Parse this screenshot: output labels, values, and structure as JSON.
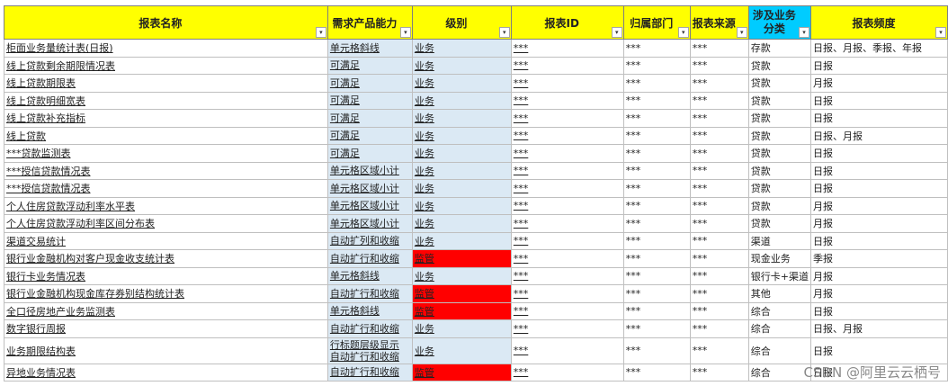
{
  "headers": [
    "报表名称",
    "需求产品能力",
    "级别",
    "报表ID",
    "归属部门",
    "报表来源",
    "涉及业务分类",
    "报表频度"
  ],
  "colors": {
    "header_yellow": "#ffff00",
    "header_cyan": "#00ccff",
    "level_red": "#ff0000",
    "link_purple": "#800080"
  },
  "rows": [
    {
      "name": "柜面业务量统计表(日报)",
      "cap": "单元格斜线",
      "level": "业务",
      "level_red": false,
      "id": "***",
      "dept": "***",
      "src": "***",
      "cat": "存款",
      "freq": "日报、月报、季报、年报"
    },
    {
      "name": "线上贷款剩余期限情况表",
      "cap": "可满足",
      "level": "业务",
      "level_red": false,
      "id": "***",
      "dept": "***",
      "src": "***",
      "cat": "贷款",
      "freq": "日报"
    },
    {
      "name": "线上贷款期限表",
      "cap": "可满足",
      "level": "业务",
      "level_red": false,
      "id": "***",
      "dept": "***",
      "src": "***",
      "cat": "贷款",
      "freq": "月报"
    },
    {
      "name": "线上贷款明细宽表",
      "cap": "可满足",
      "level": "业务",
      "level_red": false,
      "id": "***",
      "dept": "***",
      "src": "***",
      "cat": "贷款",
      "freq": "日报"
    },
    {
      "name": "线上贷款补充指标",
      "cap": "可满足",
      "level": "业务",
      "level_red": false,
      "id": "***",
      "dept": "***",
      "src": "***",
      "cat": "贷款",
      "freq": "日报"
    },
    {
      "name": "线上贷款",
      "cap": "可满足",
      "level": "业务",
      "level_red": false,
      "id": "***",
      "dept": "***",
      "src": "***",
      "cat": "贷款",
      "freq": "日报、月报"
    },
    {
      "name": "***贷款监测表",
      "cap": "可满足",
      "level": "业务",
      "level_red": false,
      "id": "***",
      "dept": "***",
      "src": "***",
      "cat": "贷款",
      "freq": "日报"
    },
    {
      "name": "***授信贷款情况表",
      "cap": "单元格区域小计",
      "level": "业务",
      "level_red": false,
      "id": "***",
      "dept": "***",
      "src": "***",
      "cat": "贷款",
      "freq": "日报"
    },
    {
      "name": "***授信贷款情况表",
      "cap": "单元格区域小计",
      "level": "业务",
      "level_red": false,
      "id": "***",
      "dept": "***",
      "src": "***",
      "cat": "贷款",
      "freq": "日报"
    },
    {
      "name": "个人住房贷款浮动利率水平表",
      "cap": "单元格区域小计",
      "level": "业务",
      "level_red": false,
      "id": "***",
      "dept": "***",
      "src": "***",
      "cat": "贷款",
      "freq": "月报"
    },
    {
      "name": "个人住房贷款浮动利率区间分布表",
      "cap": "单元格区域小计",
      "level": "业务",
      "level_red": false,
      "id": "***",
      "dept": "***",
      "src": "***",
      "cat": "贷款",
      "freq": "月报"
    },
    {
      "name": "渠道交易统计",
      "cap": "自动扩列和收缩",
      "level": "业务",
      "level_red": false,
      "id": "***",
      "dept": "***",
      "src": "***",
      "cat": "渠道",
      "freq": "日报"
    },
    {
      "name": "银行业金融机构对客户现金收支统计表",
      "cap": "自动扩行和收缩",
      "level": "监管",
      "level_red": true,
      "id": "***",
      "dept": "***",
      "src": "***",
      "cat": "现金业务",
      "freq": "季报"
    },
    {
      "name": "银行卡业务情况表",
      "cap": "单元格斜线",
      "level": "业务",
      "level_red": false,
      "id": "***",
      "dept": "***",
      "src": "***",
      "cat": "银行卡+渠道",
      "freq": "月报"
    },
    {
      "name": "银行业金融机构现金库存券别结构统计表",
      "cap": "自动扩行和收缩",
      "level": "监管",
      "level_red": true,
      "id": "***",
      "dept": "***",
      "src": "***",
      "cat": "其他",
      "freq": "月报"
    },
    {
      "name": "全口径房地产业务监测表",
      "cap": "单元格斜线",
      "level": "监管",
      "level_red": true,
      "id": "***",
      "dept": "***",
      "src": "***",
      "cat": "综合",
      "freq": "日报"
    },
    {
      "name": "数字银行周报",
      "cap": "自动扩行和收缩",
      "level": "业务",
      "level_red": false,
      "id": "***",
      "dept": "***",
      "src": "***",
      "cat": "综合",
      "freq": "日报、月报"
    },
    {
      "name": "业务期限结构表",
      "cap": "行标题层级显示\n自动扩行和收缩",
      "level": "业务",
      "level_red": false,
      "id": "***",
      "dept": "***",
      "src": "***",
      "cat": "综合",
      "freq": "日报"
    },
    {
      "name": "异地业务情况表",
      "cap": "自动扩行和收缩",
      "level": "监管",
      "level_red": true,
      "id": "***",
      "dept": "***",
      "src": "***",
      "cat": "综合",
      "freq": "日报"
    }
  ],
  "watermark": "CSDN @阿里云云栖号",
  "filter_icon": "▾"
}
